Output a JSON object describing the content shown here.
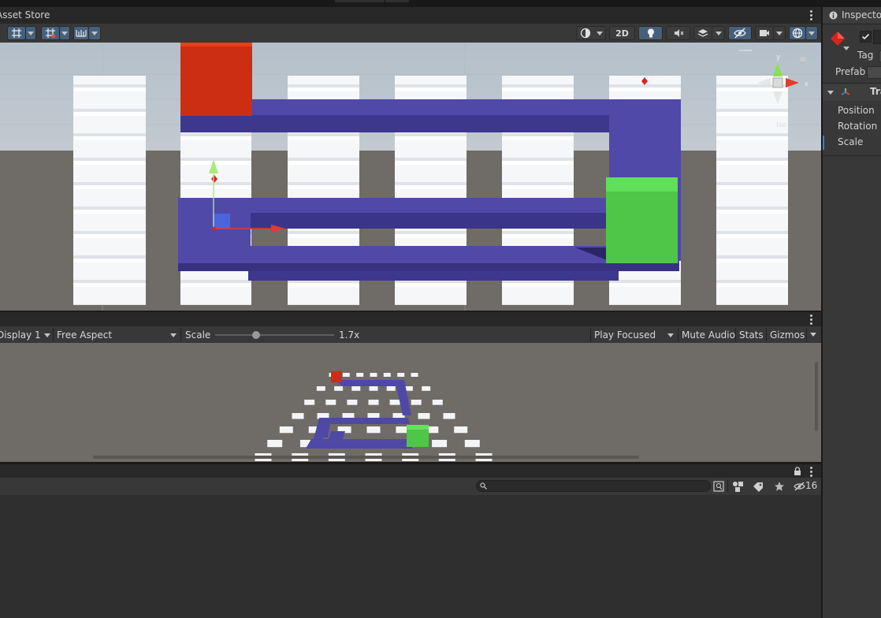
{
  "scene_panel": {
    "tab_label": "Asset Store",
    "toolbar": {
      "mode_2d_label": "2D"
    },
    "gizmo": {
      "y_label": "y",
      "x_label": "x",
      "projection_label": "Iso"
    }
  },
  "game_panel": {
    "display_label": "Display 1",
    "aspect_label": "Free Aspect",
    "scale_label": "Scale",
    "scale_value": "1.7x",
    "scale_fraction": 0.33,
    "play_mode_label": "Play Focused",
    "mute_audio_label": "Mute Audio",
    "stats_label": "Stats",
    "gizmos_label": "Gizmos"
  },
  "project_panel": {
    "hidden_count": "16"
  },
  "inspector": {
    "tab_label": "Inspector",
    "tag_label": "Tag",
    "prefab_label": "Prefab",
    "component_label": "Transform",
    "position_label": "Position",
    "rotation_label": "Rotation",
    "scale_label": "Scale"
  },
  "colors": {
    "wall_white": "#f4f6f8",
    "track_blue": "#5049a8",
    "start_red": "#cc2e12",
    "goal_green": "#4fd24a",
    "sky": "#b9c3cc",
    "ground": "#6e6a66",
    "selection_blue": "#3b7de0"
  }
}
